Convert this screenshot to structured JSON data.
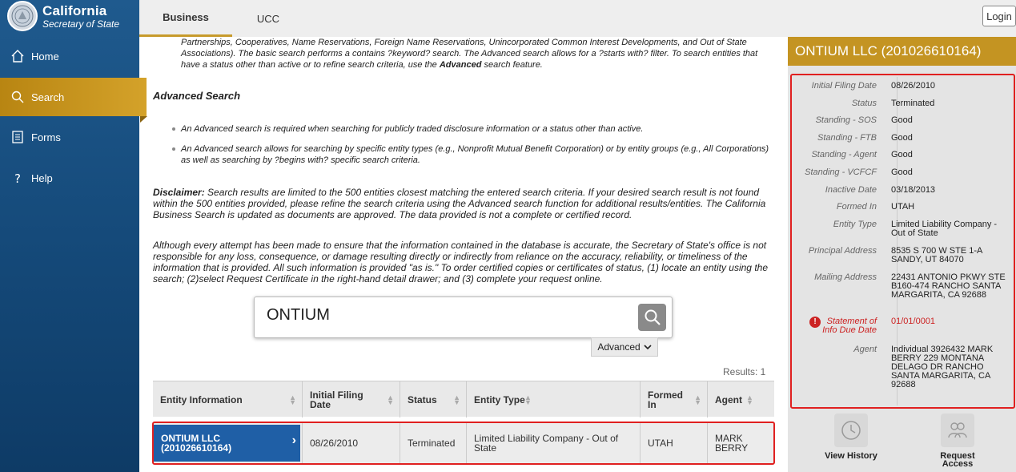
{
  "brand": {
    "title": "California",
    "subtitle": "Secretary of State"
  },
  "nav": {
    "home": "Home",
    "search": "Search",
    "forms": "Forms",
    "help": "Help"
  },
  "tabs": {
    "business": "Business",
    "ucc": "UCC"
  },
  "login": "Login",
  "main": {
    "intro": "Partnerships, Cooperatives, Name Reservations, Foreign Name Reservations, Unincorporated Common Interest Developments, and Out of State Associations). The basic search performs a contains ?keyword? search. The Advanced search allows for a ?starts with? filter. To search entities that have a status other than active or to refine search criteria, use the",
    "intro_bold": "Advanced",
    "intro_end": " search feature.",
    "advanced_heading": "Advanced Search",
    "bullet1": "An Advanced search is required when searching for publicly traded disclosure information or a status other than active.",
    "bullet2": "An Advanced search allows for searching by specific entity types (e.g., Nonprofit Mutual Benefit Corporation) or by entity groups (e.g., All Corporations) as well as searching by ?begins with? specific search criteria.",
    "disclaimer_label": "Disclaimer:",
    "disclaimer": " Search results are limited to the 500 entities closest matching the entered search criteria. If your desired search result is not found within the 500 entities provided, please refine the search criteria using the Advanced search function for additional results/entities. The California Business Search is updated as documents are approved. The data provided is not a complete or certified record.",
    "although": "Although every attempt has been made to ensure that the information contained in the database is accurate, the Secretary of State's office is not responsible for any loss, consequence, or damage resulting directly or indirectly from reliance on the accuracy, reliability, or timeliness of the information that is provided. All such information is provided \"as is.\" To order certified copies or certificates of status, (1) locate an entity using the search; (2)select Request Certificate in the right-hand detail drawer; and (3) complete your request online.",
    "search_value": "ONTIUM",
    "advanced_button": "Advanced",
    "results": "Results: 1"
  },
  "table": {
    "headers": [
      "Entity Information",
      "Initial Filing Date",
      "Status",
      "Entity Type",
      "Formed In",
      "Agent"
    ],
    "row": {
      "entity": "ONTIUM LLC (201026610164)",
      "filing_date": "08/26/2010",
      "status": "Terminated",
      "entity_type": "Limited Liability Company - Out of State",
      "formed_in": "UTAH",
      "agent": "MARK BERRY"
    }
  },
  "detail": {
    "title": "ONTIUM LLC (201026610164)",
    "fields": [
      {
        "label": "Initial Filing Date",
        "value": "08/26/2010"
      },
      {
        "label": "Status",
        "value": "Terminated"
      },
      {
        "label": "Standing - SOS",
        "value": "Good"
      },
      {
        "label": "Standing - FTB",
        "value": "Good"
      },
      {
        "label": "Standing - Agent",
        "value": "Good"
      },
      {
        "label": "Standing - VCFCF",
        "value": "Good"
      },
      {
        "label": "Inactive Date",
        "value": "03/18/2013"
      },
      {
        "label": "Formed In",
        "value": "UTAH"
      },
      {
        "label": "Entity Type",
        "value": "Limited Liability Company - Out of State"
      },
      {
        "label": "Principal Address",
        "value": "8535 S 700 W STE 1-A SANDY, UT 84070"
      },
      {
        "label": "Mailing Address",
        "value": "22431 ANTONIO PKWY STE B160-474 RANCHO SANTA MARGARITA, CA 92688"
      },
      {
        "label": "Statement of Info Due Date",
        "value": "01/01/0001"
      },
      {
        "label": "Agent",
        "value": "Individual 3926432 MARK BERRY 229 MONTANA DELAGO DR RANCHO SANTA MARGARITA, CA 92688"
      }
    ],
    "actions": {
      "history": "View History",
      "access": "Request Access"
    },
    "warning_color": "#cc2222"
  },
  "colors": {
    "sidebar": "#1a5288",
    "accent": "#c49422",
    "highlight": "#e02020",
    "entity_cell": "#1f5fa6"
  }
}
